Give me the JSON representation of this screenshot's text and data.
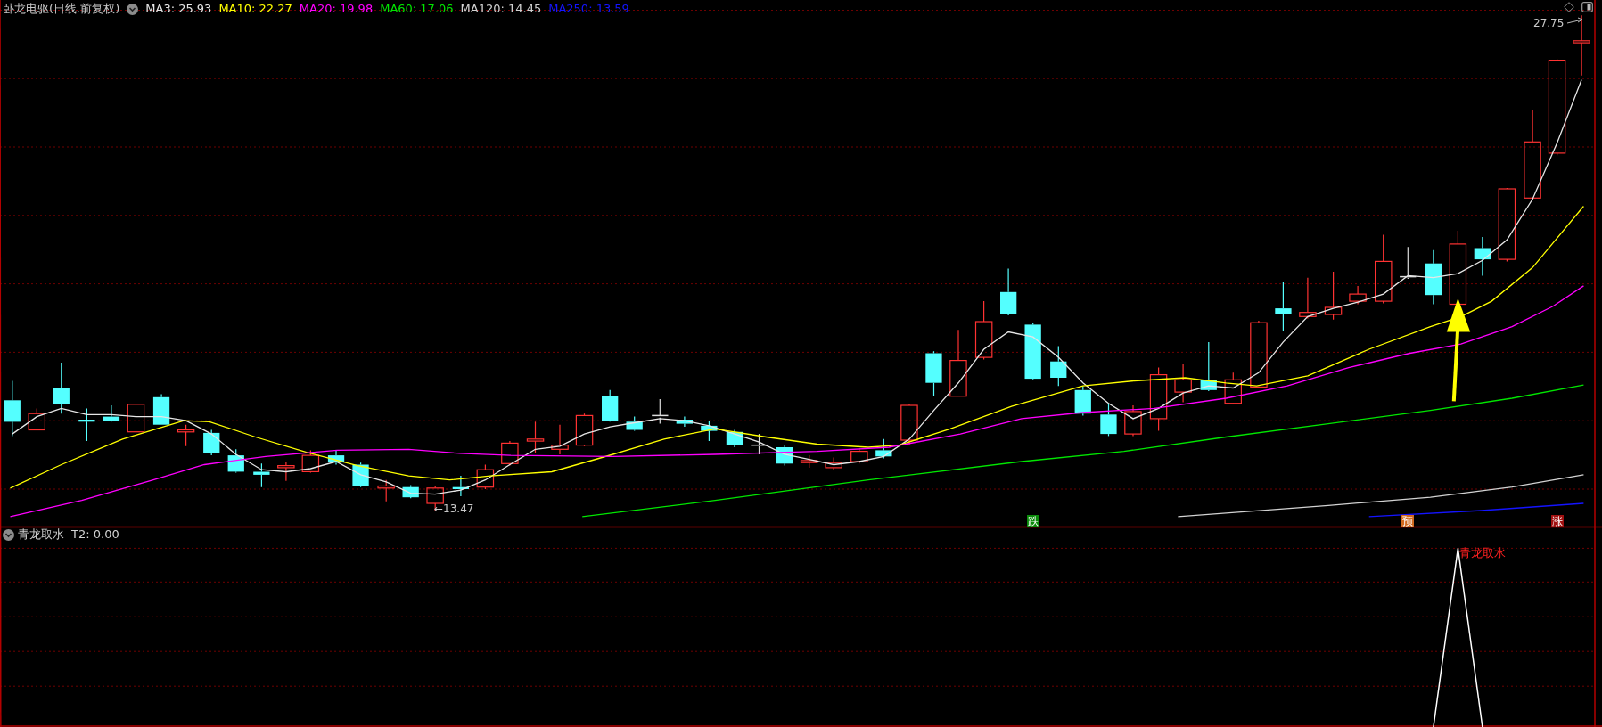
{
  "title": "卧龙电驱(日线.前复权)",
  "moving_averages": [
    {
      "text": "MA3: 25.93",
      "color": "#e6e6e6"
    },
    {
      "text": "MA10: 22.27",
      "color": "#ffff00"
    },
    {
      "text": "MA20: 19.98",
      "color": "#ff00ff"
    },
    {
      "text": "MA60: 17.06",
      "color": "#00e600"
    },
    {
      "text": "MA120: 14.45",
      "color": "#d2d2d2"
    },
    {
      "text": "MA250: 13.59",
      "color": "#1414ff"
    }
  ],
  "price_labels": {
    "high": "27.75",
    "low": "←13.47"
  },
  "signals": [
    {
      "text": "跌",
      "color": "#0a8a0a"
    },
    {
      "text": "预",
      "color": "#d2691e"
    },
    {
      "text": "涨",
      "color": "#a01010"
    }
  ],
  "indicator": {
    "name": "青龙取水",
    "reading": "T2: 0.00",
    "signal_label": "青龙取水"
  }
}
